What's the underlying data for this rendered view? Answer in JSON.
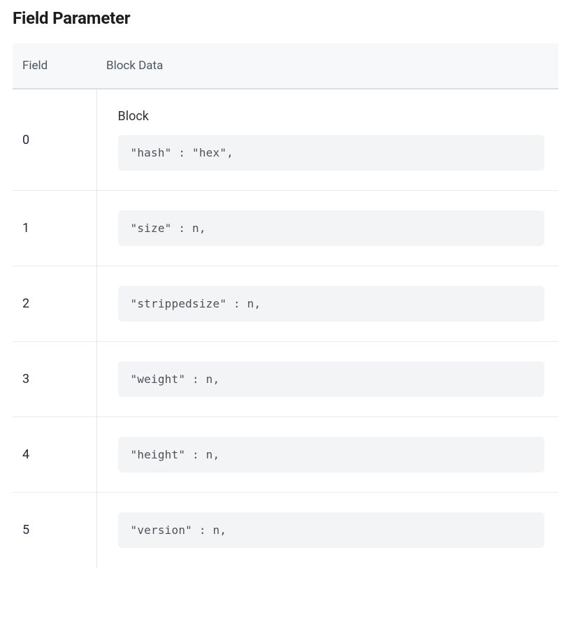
{
  "title": "Field Parameter",
  "table": {
    "columns": [
      "Field",
      "Block Data"
    ],
    "rows": [
      {
        "field": "0",
        "label": "Block",
        "code": "\"hash\" : \"hex\","
      },
      {
        "field": "1",
        "label": null,
        "code": "\"size\" : n,"
      },
      {
        "field": "2",
        "label": null,
        "code": "\"strippedsize\" : n,"
      },
      {
        "field": "3",
        "label": null,
        "code": "\"weight\" : n,"
      },
      {
        "field": "4",
        "label": null,
        "code": "\"height\" : n,"
      },
      {
        "field": "5",
        "label": null,
        "code": "\"version\" : n,"
      }
    ]
  }
}
